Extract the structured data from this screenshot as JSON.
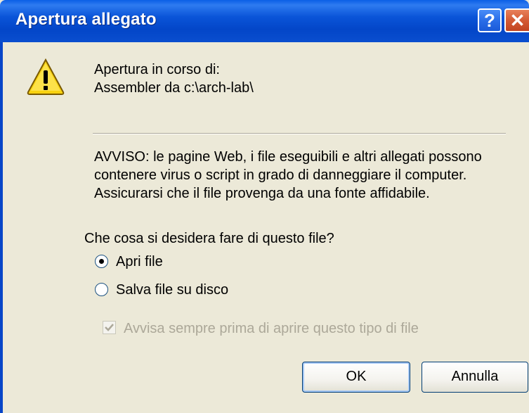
{
  "window": {
    "title": "Apertura allegato",
    "help_glyph": "?",
    "close_glyph": "✕"
  },
  "header": {
    "line1": "Apertura in corso di:",
    "line2": "Assembler da c:\\arch-lab\\"
  },
  "warning": {
    "line1": "AVVISO: le pagine Web, i file eseguibili e altri allegati possono",
    "line2": "contenere virus o script in grado di danneggiare il computer.",
    "line3": "Assicurarsi che il file provenga da una fonte affidabile."
  },
  "question": "Che cosa si desidera fare di questo file?",
  "options": [
    {
      "label": "Apri file",
      "selected": true
    },
    {
      "label": "Salva file su disco",
      "selected": false
    }
  ],
  "checkbox": {
    "label": "Avvisa sempre prima di aprire questo tipo di file",
    "checked": true,
    "disabled": true
  },
  "buttons": {
    "ok": "OK",
    "cancel": "Annulla"
  },
  "icons": {
    "warning": "warning-icon",
    "help": "help-icon",
    "close": "close-icon"
  },
  "colors": {
    "titlebar": "#0a54d8",
    "dialog_bg": "#ece9d8",
    "close_button": "#d45a34",
    "disabled_text": "#aca899"
  }
}
